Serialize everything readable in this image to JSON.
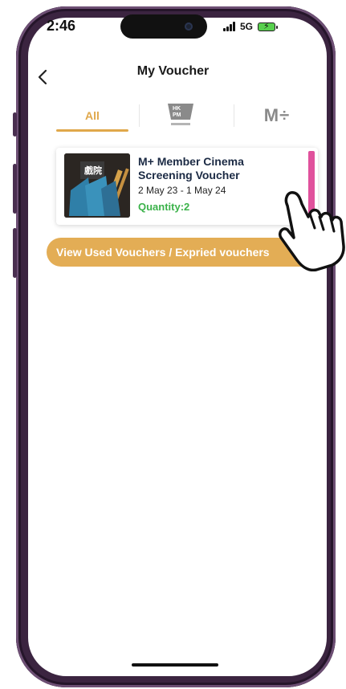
{
  "status_bar": {
    "time": "2:46",
    "network": "5G",
    "signal_icon": "signal-bars-icon",
    "battery_icon": "battery-charging-icon"
  },
  "nav": {
    "back_icon": "chevron-left-icon",
    "title": "My Voucher"
  },
  "tabs": [
    {
      "label": "All",
      "selected": true
    },
    {
      "label": "HK PM",
      "icon": "hkpm-logo-icon"
    },
    {
      "label": "M+",
      "icon": "mplus-logo-icon"
    }
  ],
  "voucher": {
    "title": "M+ Member Cinema Screening Voucher",
    "dates": "2 May 23 - 1 May 24",
    "quantity": "Quantity:2",
    "accent_color": "#e0519c",
    "thumbnail_text": "戲院"
  },
  "used_button": {
    "label": "View Used Vouchers / Expried vouchers"
  },
  "colors": {
    "accent": "#e0a84b",
    "quantity_green": "#3bb24a",
    "title_navy": "#1b2a44",
    "phone_frame": "#3b2440"
  }
}
